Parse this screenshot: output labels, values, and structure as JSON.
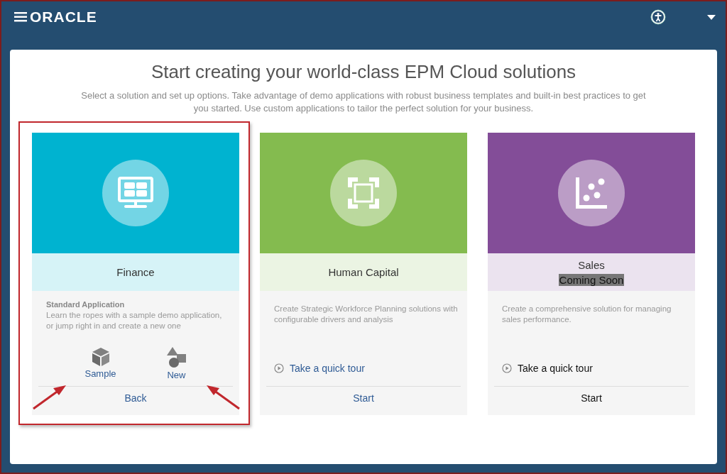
{
  "header": {
    "logo": "ORACLE"
  },
  "panel": {
    "title": "Start creating your world-class EPM Cloud solutions",
    "subtitle": "Select a solution and set up options. Take advantage of demo applications with robust business templates and built-in best practices to get you started. Use custom applications to tailor the perfect solution for your business."
  },
  "cards": [
    {
      "kind": "options",
      "name": "Finance",
      "color": "#00b3d0",
      "highlighted": true,
      "disabled": false,
      "heading": "Standard Application",
      "description": "Learn the ropes with a sample demo application, or jump right in and create a new one",
      "actions": [
        {
          "label": "Sample",
          "pointed": true
        },
        {
          "label": "New",
          "pointed": true
        }
      ],
      "footer": "Back"
    },
    {
      "kind": "tour",
      "name": "Human Capital",
      "color": "#84bb4f",
      "highlighted": false,
      "disabled": false,
      "description": "Create Strategic Workforce Planning solutions with configurable drivers and analysis",
      "tour": "Take a quick tour",
      "footer": "Start"
    },
    {
      "kind": "tour",
      "name": "Sales",
      "color": "#834d98",
      "highlighted": false,
      "disabled": true,
      "badge": "Coming Soon",
      "description": "Create a comprehensive solution for managing sales performance.",
      "tour": "Take a quick tour",
      "footer": "Start"
    }
  ]
}
